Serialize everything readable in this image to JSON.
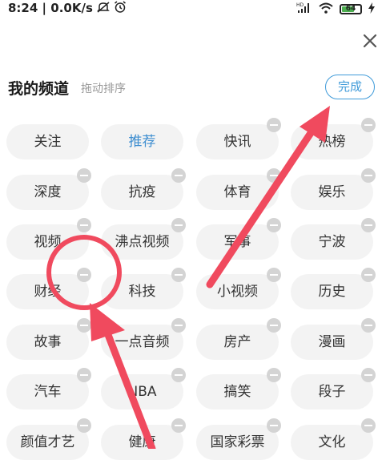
{
  "status_bar": {
    "time": "8:24",
    "speed": "0.0K/s",
    "battery_level": "64",
    "icons": [
      "mute-icon",
      "alarm-icon",
      "hd-signal-icon",
      "wifi-icon",
      "battery-icon",
      "charging-icon"
    ]
  },
  "header": {
    "title": "我的频道",
    "subtitle": "拖动排序",
    "done_label": "完成"
  },
  "colors": {
    "accent": "#3e9ad9",
    "active_chip_text": "#3e8ed0",
    "chip_background": "#f3f3f3",
    "remove_badge": "#d4d4d4",
    "annotation": "#f04a5e"
  },
  "channels": [
    {
      "label": "关注",
      "active": false,
      "removable": false
    },
    {
      "label": "推荐",
      "active": true,
      "removable": false
    },
    {
      "label": "快讯",
      "active": false,
      "removable": true
    },
    {
      "label": "热榜",
      "active": false,
      "removable": true
    },
    {
      "label": "深度",
      "active": false,
      "removable": true
    },
    {
      "label": "抗疫",
      "active": false,
      "removable": true
    },
    {
      "label": "体育",
      "active": false,
      "removable": true
    },
    {
      "label": "娱乐",
      "active": false,
      "removable": true
    },
    {
      "label": "视频",
      "active": false,
      "removable": true
    },
    {
      "label": "沸点视频",
      "active": false,
      "removable": true
    },
    {
      "label": "军事",
      "active": false,
      "removable": true
    },
    {
      "label": "宁波",
      "active": false,
      "removable": true
    },
    {
      "label": "财经",
      "active": false,
      "removable": true
    },
    {
      "label": "科技",
      "active": false,
      "removable": true
    },
    {
      "label": "小视频",
      "active": false,
      "removable": true
    },
    {
      "label": "历史",
      "active": false,
      "removable": true
    },
    {
      "label": "故事",
      "active": false,
      "removable": true
    },
    {
      "label": "一点音频",
      "active": false,
      "removable": true
    },
    {
      "label": "房产",
      "active": false,
      "removable": true
    },
    {
      "label": "漫画",
      "active": false,
      "removable": true
    },
    {
      "label": "汽车",
      "active": false,
      "removable": true
    },
    {
      "label": "NBA",
      "active": false,
      "removable": true
    },
    {
      "label": "搞笑",
      "active": false,
      "removable": true
    },
    {
      "label": "段子",
      "active": false,
      "removable": true
    },
    {
      "label": "颜值才艺",
      "active": false,
      "removable": true
    },
    {
      "label": "健康",
      "active": false,
      "removable": true
    },
    {
      "label": "国家彩票",
      "active": false,
      "removable": true
    },
    {
      "label": "文化",
      "active": false,
      "removable": true
    }
  ]
}
